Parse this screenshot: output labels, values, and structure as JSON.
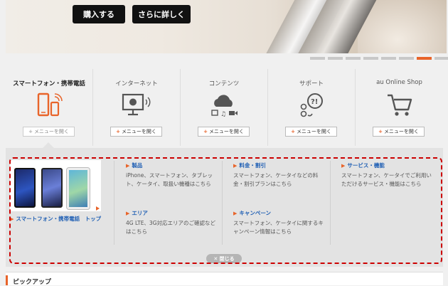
{
  "hero": {
    "buy_label": "購入する",
    "details_label": "さらに詳しく"
  },
  "slides": {
    "count": 8,
    "active_index": 6
  },
  "nav": [
    {
      "title": "スマートフォン・携帯電話",
      "menu_label": "メニューを開く",
      "icon": "smartphone-icon",
      "active": true
    },
    {
      "title": "インターネット",
      "menu_label": "メニューを開く",
      "icon": "monitor-wifi-icon"
    },
    {
      "title": "コンテンツ",
      "menu_label": "メニューを開く",
      "icon": "cloud-media-icon"
    },
    {
      "title": "サポート",
      "menu_label": "メニューを開く",
      "icon": "chat-question-icon"
    },
    {
      "title": "au Online Shop",
      "menu_label": "メニューを開く",
      "icon": "cart-icon"
    }
  ],
  "dropdown": {
    "top_link": "スマートフォン・携帯電話　トップ",
    "categories": [
      {
        "title": "製品",
        "desc": "iPhone、スマートフォン、タブレット、ケータイ、取扱い機種はこちら"
      },
      {
        "title": "エリア",
        "desc": "4G LTE、3G対応エリアのご確認などはこちら"
      },
      {
        "title": "料金・割引",
        "desc": "スマートフォン、ケータイなどの料金・割引プランはこちら"
      },
      {
        "title": "キャンペーン",
        "desc": "スマートフォン、ケータイに関するキャンペーン情報はこちら"
      },
      {
        "title": "サービス・機能",
        "desc": "スマートフォン、ケータイでご利用いただけるサービス・機能はこちら"
      }
    ],
    "close_label": "✕ 閉じる"
  },
  "pickup": {
    "label": "ピックアップ"
  },
  "colors": {
    "accent": "#e8642a",
    "link": "#1f5fb4",
    "highlight_border": "#cc0000"
  }
}
